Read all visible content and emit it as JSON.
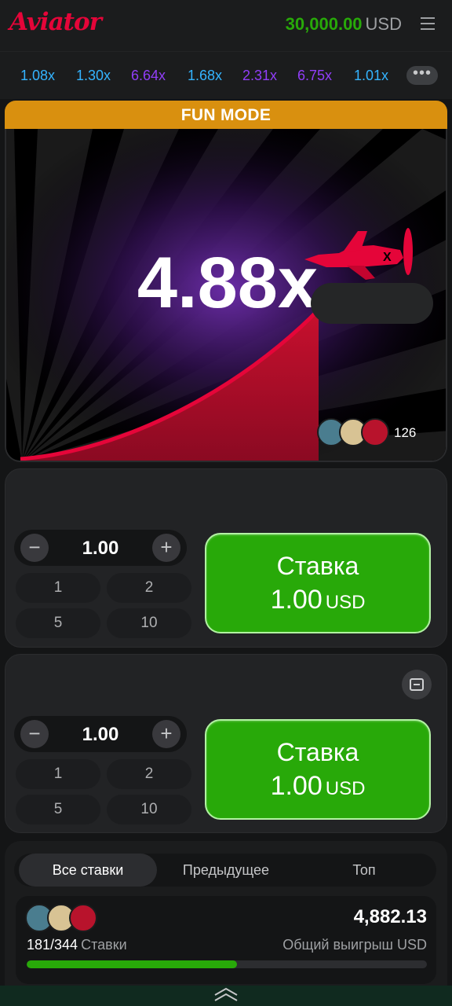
{
  "header": {
    "logo": "Aviator",
    "balance_amount": "30,000.00",
    "balance_currency": "USD"
  },
  "history": [
    {
      "value": "1.08x",
      "color": "#34b4ff"
    },
    {
      "value": "1.30x",
      "color": "#34b4ff"
    },
    {
      "value": "6.64x",
      "color": "#913ef8"
    },
    {
      "value": "1.68x",
      "color": "#34b4ff"
    },
    {
      "value": "2.31x",
      "color": "#913ef8"
    },
    {
      "value": "6.75x",
      "color": "#913ef8"
    },
    {
      "value": "1.01x",
      "color": "#34b4ff"
    }
  ],
  "game": {
    "mode_label": "FUN MODE",
    "multiplier": "4.88x",
    "players_count": "126"
  },
  "bet_panels": [
    {
      "amount": "1.00",
      "quick_amounts": [
        "1",
        "2",
        "5",
        "10"
      ],
      "button_label": "Ставка",
      "button_amount": "1.00",
      "button_currency": "USD"
    },
    {
      "amount": "1.00",
      "quick_amounts": [
        "1",
        "2",
        "5",
        "10"
      ],
      "button_label": "Ставка",
      "button_amount": "1.00",
      "button_currency": "USD"
    }
  ],
  "bets": {
    "tabs": [
      "Все ставки",
      "Предыдущее",
      "Топ"
    ],
    "total_win": "4,882.13",
    "bets_count": "181/344",
    "bets_label": "Ставки",
    "total_win_label": "Общий выигрыш USD",
    "progress_fraction": 0.526
  },
  "colors": {
    "accent_green": "#28a909",
    "brand_red": "#e50539",
    "fun_mode": "#d9900f"
  }
}
